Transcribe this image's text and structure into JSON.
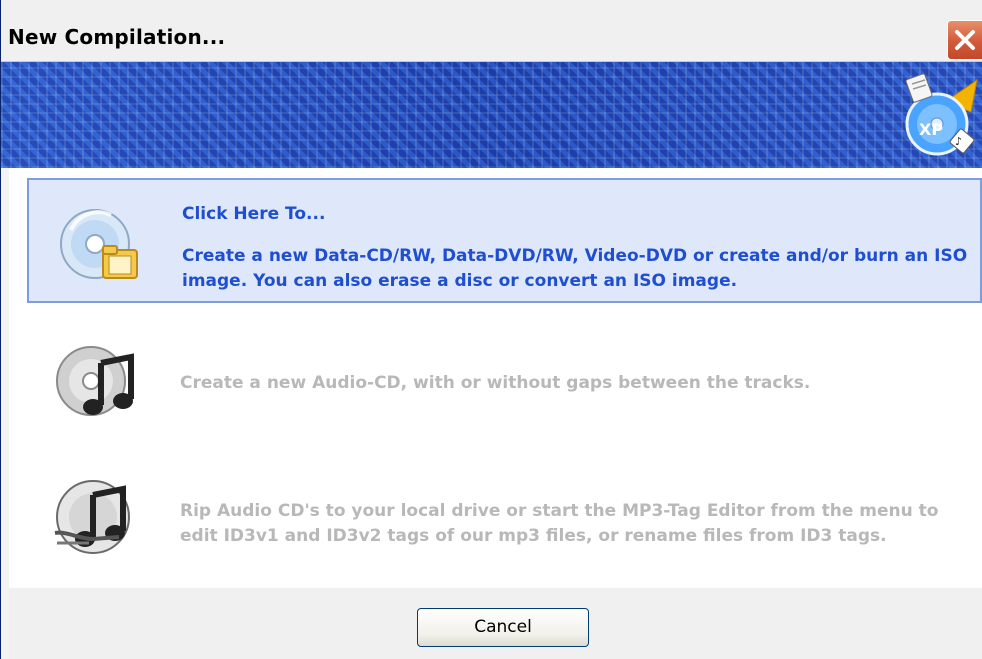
{
  "window": {
    "title": "New Compilation...",
    "close_label": "Close"
  },
  "options": [
    {
      "heading": "Click Here To...",
      "text": "Create a new Data-CD/RW, Data-DVD/RW, Video-DVD or create and/or burn an ISO image. You can also erase a disc or convert an ISO image.",
      "icon": "data-cd-icon",
      "state": "selected"
    },
    {
      "text": "Create a new Audio-CD, with or without gaps between the tracks.",
      "icon": "audio-cd-icon",
      "state": "disabled"
    },
    {
      "text": "Rip Audio CD's to your local drive or start the MP3-Tag Editor from the menu to edit ID3v1 and ID3v2 tags of our mp3 files, or rename files from ID3 tags.",
      "icon": "rip-audio-icon",
      "state": "disabled"
    }
  ],
  "banner": {
    "logo_text": "XP",
    "logo_icon": "burnaware-xp-logo-icon"
  },
  "buttons": {
    "cancel": "Cancel"
  },
  "colors": {
    "accent_text": "#1f4fd0",
    "selected_bg": "#dfe8fb",
    "selected_border": "#7f9ddc",
    "banner_blue": "#1f47b8",
    "disabled_text": "#b8b8b8"
  }
}
